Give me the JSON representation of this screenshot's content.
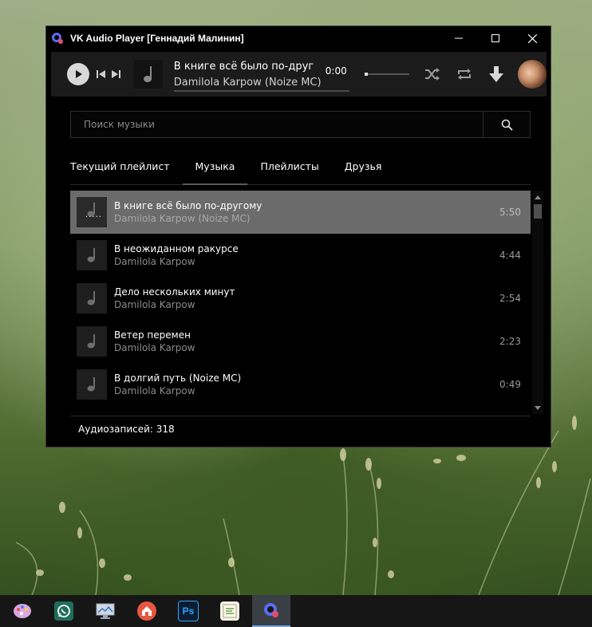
{
  "window": {
    "title": "VK Audio Player [Геннадий Малинин]",
    "minimize": "—",
    "maximize": "☐",
    "close": "✕"
  },
  "player": {
    "now_playing_title": "В книге всё было по-друг…",
    "now_playing_artist": "Damilola Karpow (Noize MC)",
    "time": "0:00",
    "progress": 0,
    "volume": 0
  },
  "search": {
    "placeholder": "Поиск музыки",
    "value": ""
  },
  "tabs": [
    {
      "label": "Текущий плейлист",
      "active": false
    },
    {
      "label": "Музыка",
      "active": true
    },
    {
      "label": "Плейлисты",
      "active": false
    },
    {
      "label": "Друзья",
      "active": false
    }
  ],
  "tracks": [
    {
      "title": "В книге всё было по-другому",
      "artist": "Damilola Karpow (Noize MC)",
      "duration": "5:50",
      "playing": true,
      "indicator": "....."
    },
    {
      "title": "В неожиданном ракурсе",
      "artist": "Damilola Karpow",
      "duration": "4:44",
      "playing": false
    },
    {
      "title": "Дело нескольких минут",
      "artist": "Damilola Karpow",
      "duration": "2:54",
      "playing": false
    },
    {
      "title": "Ветер перемен",
      "artist": "Damilola Karpow",
      "duration": "2:23",
      "playing": false
    },
    {
      "title": "В долгий путь (Noize MC)",
      "artist": "Damilola Karpow",
      "duration": "0:49",
      "playing": false
    }
  ],
  "footer": {
    "count_label": "Аудиозаписей: 318"
  },
  "taskbar": {
    "items": [
      {
        "name": "paint-icon",
        "active": false
      },
      {
        "name": "whatsapp-icon",
        "active": false
      },
      {
        "name": "monitor-icon",
        "active": false
      },
      {
        "name": "home-icon",
        "active": false
      },
      {
        "name": "photoshop-icon",
        "label": "Ps",
        "active": false
      },
      {
        "name": "notepad-icon",
        "active": false
      },
      {
        "name": "vk-audio-player-icon",
        "active": true
      }
    ]
  },
  "colors": {
    "window_bg": "#000000",
    "player_bar_bg": "#1b1b1b",
    "playing_row_bg": "#6b6b6b",
    "muted_text": "#8c8c8c",
    "app_icon_accent": "#5b6cf0"
  }
}
